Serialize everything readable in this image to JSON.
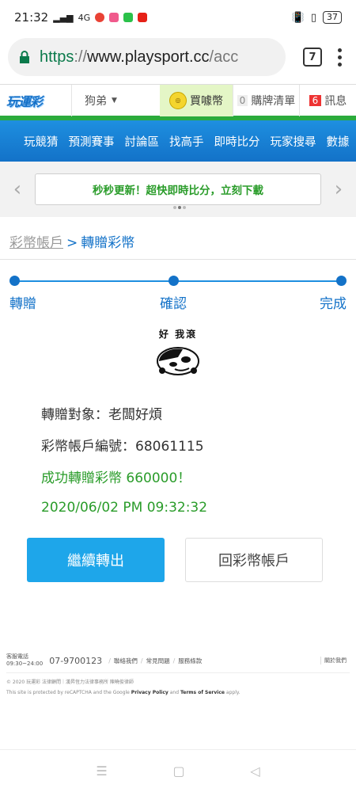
{
  "status_bar": {
    "time": "21:32",
    "signal": "4G",
    "battery": "37"
  },
  "browser": {
    "url_scheme": "https",
    "url_sep": "://",
    "url_host": "www.playsport.cc",
    "url_rest": "/acc",
    "tab_count": "7"
  },
  "site_header": {
    "logo": "玩運彩",
    "user_name": "狗弟",
    "coin_icon": "coin-icon",
    "coin_label": "買噱幣",
    "cart_count": "0",
    "cart_label": "購牌清單",
    "msg_count": "6",
    "msg_label": "訊息"
  },
  "main_nav": {
    "items": [
      "玩競猜",
      "預測賽事",
      "討論區",
      "找高手",
      "即時比分",
      "玩家搜尋",
      "數據"
    ]
  },
  "promo": {
    "text": "秒秒更新！超快即時比分，立刻下載"
  },
  "breadcrumb": {
    "parent": "彩幣帳戶",
    "separator": ">",
    "current": "轉贈彩幣"
  },
  "steps": [
    "轉贈",
    "確認",
    "完成"
  ],
  "sticker": {
    "text": "好 我滾"
  },
  "result": {
    "recipient": "轉贈對象：老闆好煩",
    "account": "彩幣帳戶編號：68061115",
    "success": "成功轉贈彩幣 660000！",
    "timestamp": "2020/06/02 PM 09:32:32"
  },
  "actions": {
    "continue_label": "繼續轉出",
    "back_label": "回彩幣帳戶"
  },
  "footer": {
    "service_label": "客服電話",
    "service_hours": "09:30~24:00",
    "phone": "07-9700123",
    "links": [
      "聯絡我們",
      "常見問題",
      "服務條款"
    ],
    "about": "關於我們",
    "copyright": "© 2020 玩運彩 法律顧問｜漢昇恆力法律事務所 陳曉俊律師",
    "recaptcha_prefix": "This site is protected by reCAPTCHA and the Google",
    "privacy": "Privacy Policy",
    "and": "and",
    "terms": "Terms of Service",
    "apply": "apply."
  },
  "colors": {
    "brand_blue": "#1372c8",
    "accent_green": "#2a9c2a",
    "button_blue": "#1ea6ea"
  }
}
